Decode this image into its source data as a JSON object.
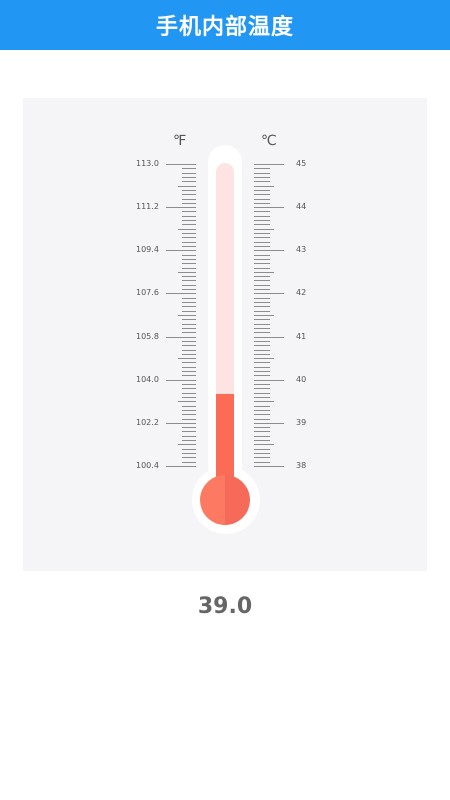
{
  "header": {
    "title": "手机内部温度"
  },
  "thermometer": {
    "fahrenheit_unit": "℉",
    "celsius_unit": "℃",
    "fahrenheit_labels": [
      "113.0",
      "111.2",
      "109.4",
      "107.6",
      "105.8",
      "104.0",
      "102.2",
      "100.4"
    ],
    "celsius_labels": [
      "45",
      "44",
      "43",
      "42",
      "41",
      "40",
      "39",
      "38"
    ],
    "scale_min_c": 38,
    "scale_max_c": 45,
    "current_c": 39.0,
    "colors": {
      "mercury": "#fb6b56",
      "tube": "#fde4e2",
      "bulb_light": "#fd7961",
      "bulb_dark": "#f56a58"
    }
  },
  "reading": {
    "value": "39.0"
  }
}
